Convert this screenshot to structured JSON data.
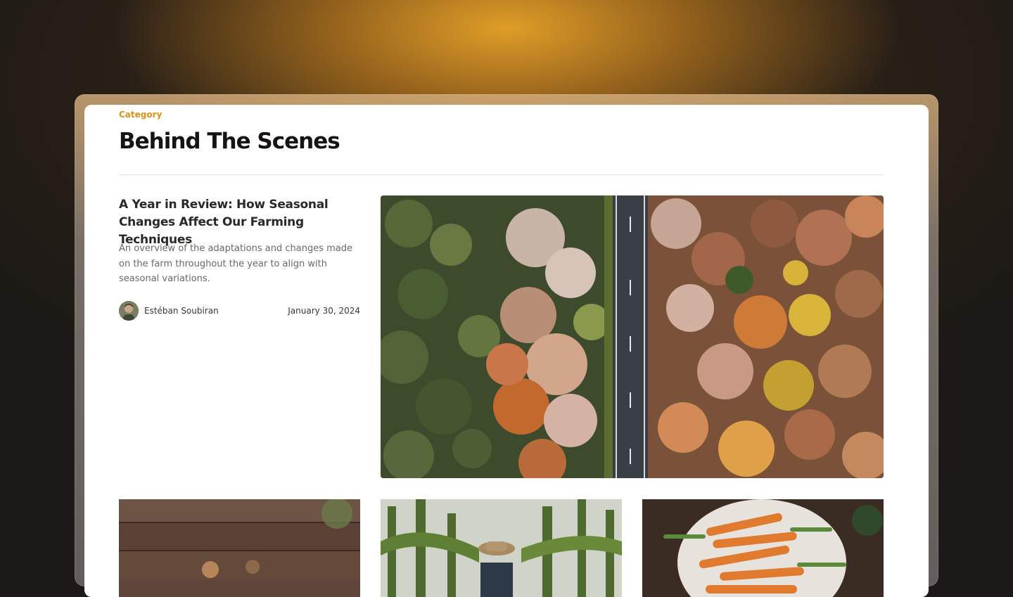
{
  "category": {
    "label": "Category"
  },
  "page": {
    "title": "Behind The Scenes"
  },
  "featured": {
    "title": "A Year in Review: How Seasonal Changes Affect Our Farming Techniques",
    "description": "An overview of the adaptations and changes made on the farm throughout the year to align with seasonal variations.",
    "author": "Estéban Soubiran",
    "date": "January 30, 2024"
  },
  "colors": {
    "accent": "#d9941c",
    "background": "#1c1916"
  }
}
